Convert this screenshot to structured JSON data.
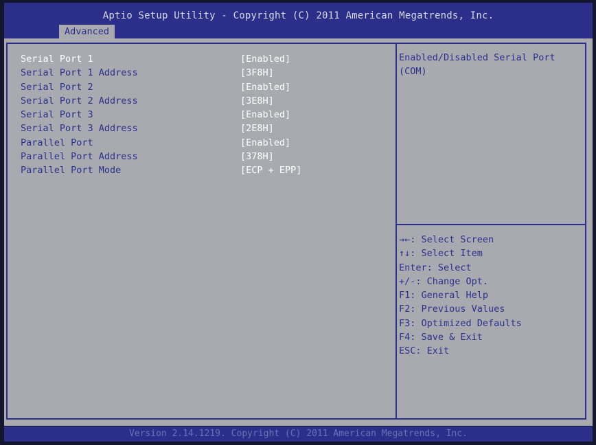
{
  "header": {
    "title": "Aptio Setup Utility - Copyright (C) 2011 American Megatrends, Inc.",
    "active_tab": "Advanced"
  },
  "settings": [
    {
      "label": "Serial Port 1",
      "value": "[Enabled]",
      "selected": true
    },
    {
      "label": "Serial Port 1 Address",
      "value": "[3F8H]",
      "selected": false
    },
    {
      "label": "Serial Port 2",
      "value": "[Enabled]",
      "selected": false
    },
    {
      "label": "Serial Port 2 Address",
      "value": "[3E8H]",
      "selected": false
    },
    {
      "label": "Serial Port 3",
      "value": "[Enabled]",
      "selected": false
    },
    {
      "label": "Serial Port 3 Address",
      "value": "[2E8H]",
      "selected": false
    },
    {
      "label": "Parallel Port",
      "value": "[Enabled]",
      "selected": false
    },
    {
      "label": "Parallel Port Address",
      "value": "[378H]",
      "selected": false
    },
    {
      "label": "Parallel Port Mode",
      "value": "[ECP + EPP]",
      "selected": false
    }
  ],
  "help": {
    "text": "Enabled/Disabled Serial Port\n(COM)"
  },
  "keys": [
    "→←: Select Screen",
    "↑↓: Select Item",
    "Enter: Select",
    "+/-: Change Opt.",
    "F1: General Help",
    "F2: Previous Values",
    "F3: Optimized Defaults",
    "F4: Save & Exit",
    "ESC: Exit"
  ],
  "footer": {
    "text": "Version 2.14.1219. Copyright (C) 2011 American Megatrends, Inc."
  },
  "colors": {
    "header_bg": "#2b2f8a",
    "panel_bg": "#a9aab0",
    "label_text": "#2b2f8a",
    "value_text": "#ffffff",
    "selected_text": "#ffffff"
  }
}
